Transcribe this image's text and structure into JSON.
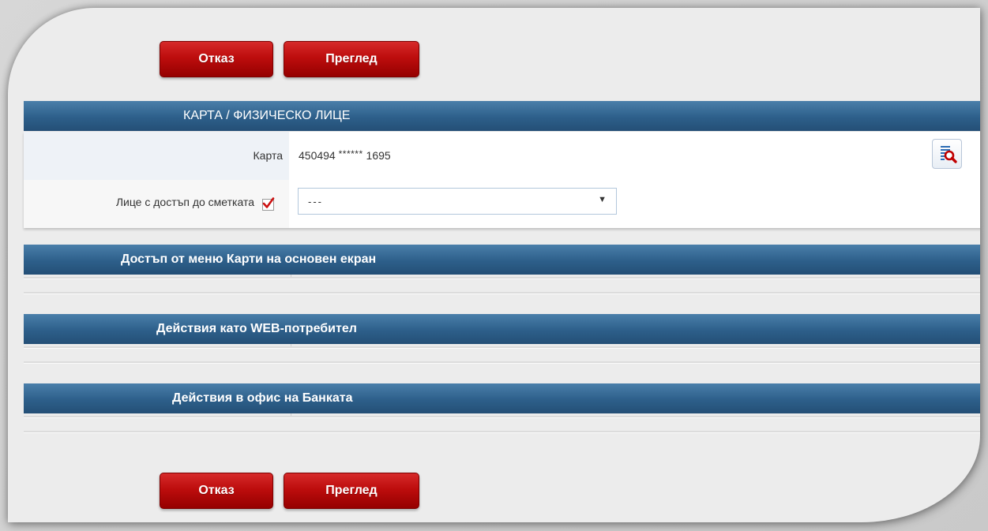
{
  "buttons": {
    "cancel_label": "Отказ",
    "review_label": "Преглед"
  },
  "card_section": {
    "title": "КАРТА / ФИЗИЧЕСКО ЛИЦЕ",
    "card_label": "Карта",
    "card_prefix": "450494",
    "card_masked": "******",
    "card_suffix": "1695",
    "person_label": "Лице с достъп до сметката",
    "person_checkbox_checked": true,
    "person_select_value": "---"
  },
  "sections": [
    {
      "title": "Достъп от меню Карти на основен екран"
    },
    {
      "title": "Действия като WEB-потребител"
    },
    {
      "title": "Действия в офис на Банката"
    }
  ],
  "colors": {
    "accent_red": "#c41010",
    "header_blue": "#2d5f8a",
    "checkmark_red": "#cc1111"
  }
}
